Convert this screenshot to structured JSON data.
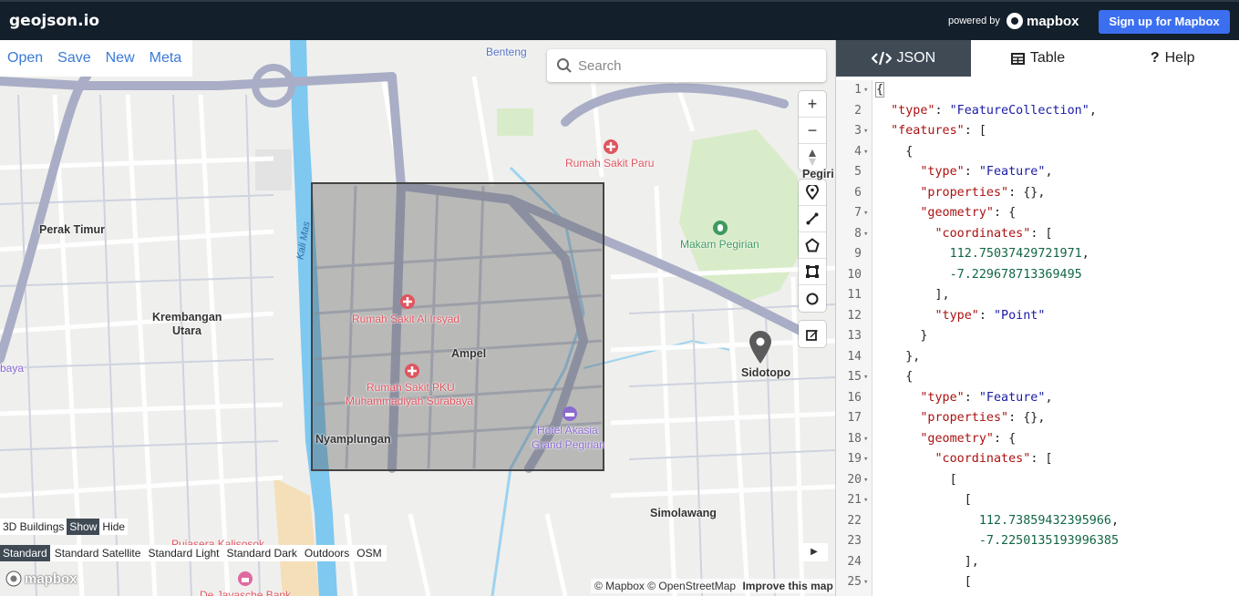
{
  "topbar": {
    "brand": "geojson.io",
    "powered_by": "powered by",
    "mapbox_logo": "mapbox",
    "signup": "Sign up for Mapbox"
  },
  "file_menu": {
    "open": "Open",
    "save": "Save",
    "new": "New",
    "meta": "Meta"
  },
  "search": {
    "placeholder": "Search"
  },
  "map_labels": {
    "benteng": "Benteng",
    "perak_timur": "Perak Timur",
    "krembangan": "Krembangan",
    "krembangan2": "Utara",
    "baya": "baya",
    "rs_paru": "Rumah Sakit Paru",
    "makam": "Makam Pegirian",
    "pegiri": "Pegiri",
    "kali_mas": "Kali Mas",
    "rs_alirsyad": "Rumah Sakit Al Irsyad",
    "ampel": "Ampel",
    "rs_pku1": "Rumah Sakit PKU",
    "rs_pku2": "Muhammadiyah Surabaya",
    "hotel1": "Hotel Akasia",
    "hotel2": "Grand Pegirian",
    "nyamplungan": "Nyamplungan",
    "sidotopo": "Sidotopo",
    "simolawang": "Simolawang",
    "pujasera": "Pujasera Kalisosok",
    "de_javasche": "De Javasche Bank"
  },
  "layers3d": {
    "label": "3D Buildings",
    "show": "Show",
    "hide": "Hide"
  },
  "styles": [
    "Standard",
    "Standard Satellite",
    "Standard Light",
    "Standard Dark",
    "Outdoors",
    "OSM"
  ],
  "attribution": {
    "text": "© Mapbox © OpenStreetMap",
    "improve": "Improve this map"
  },
  "mapbox_wordmark": "mapbox",
  "tabs": {
    "json": "JSON",
    "table": "Table",
    "help": "Help"
  },
  "editor_lines": [
    {
      "n": "1",
      "fold": true,
      "html": "<span class='cursor-brace'>{</span>"
    },
    {
      "n": "2",
      "fold": false,
      "html": "  <span class='k'>\"type\"</span>: <span class='s'>\"FeatureCollection\"</span>,"
    },
    {
      "n": "3",
      "fold": true,
      "html": "  <span class='k'>\"features\"</span>: ["
    },
    {
      "n": "4",
      "fold": true,
      "html": "    {"
    },
    {
      "n": "5",
      "fold": false,
      "html": "      <span class='k'>\"type\"</span>: <span class='s'>\"Feature\"</span>,"
    },
    {
      "n": "6",
      "fold": false,
      "html": "      <span class='k'>\"properties\"</span>: {},"
    },
    {
      "n": "7",
      "fold": true,
      "html": "      <span class='k'>\"geometry\"</span>: {"
    },
    {
      "n": "8",
      "fold": true,
      "html": "        <span class='k'>\"coordinates\"</span>: ["
    },
    {
      "n": "9",
      "fold": false,
      "html": "          <span class='n'>112.75037429721971</span>,"
    },
    {
      "n": "10",
      "fold": false,
      "html": "          <span class='n'>-7.229678713369495</span>"
    },
    {
      "n": "11",
      "fold": false,
      "html": "        ],"
    },
    {
      "n": "12",
      "fold": false,
      "html": "        <span class='k'>\"type\"</span>: <span class='s'>\"Point\"</span>"
    },
    {
      "n": "13",
      "fold": false,
      "html": "      }"
    },
    {
      "n": "14",
      "fold": false,
      "html": "    },"
    },
    {
      "n": "15",
      "fold": true,
      "html": "    {"
    },
    {
      "n": "16",
      "fold": false,
      "html": "      <span class='k'>\"type\"</span>: <span class='s'>\"Feature\"</span>,"
    },
    {
      "n": "17",
      "fold": false,
      "html": "      <span class='k'>\"properties\"</span>: {},"
    },
    {
      "n": "18",
      "fold": true,
      "html": "      <span class='k'>\"geometry\"</span>: {"
    },
    {
      "n": "19",
      "fold": true,
      "html": "        <span class='k'>\"coordinates\"</span>: ["
    },
    {
      "n": "20",
      "fold": true,
      "html": "          ["
    },
    {
      "n": "21",
      "fold": true,
      "html": "            ["
    },
    {
      "n": "22",
      "fold": false,
      "html": "              <span class='n'>112.73859432395966</span>,"
    },
    {
      "n": "23",
      "fold": false,
      "html": "              <span class='n'>-7.2250135193996385</span>"
    },
    {
      "n": "24",
      "fold": false,
      "html": "            ],"
    },
    {
      "n": "25",
      "fold": true,
      "html": "            ["
    }
  ]
}
